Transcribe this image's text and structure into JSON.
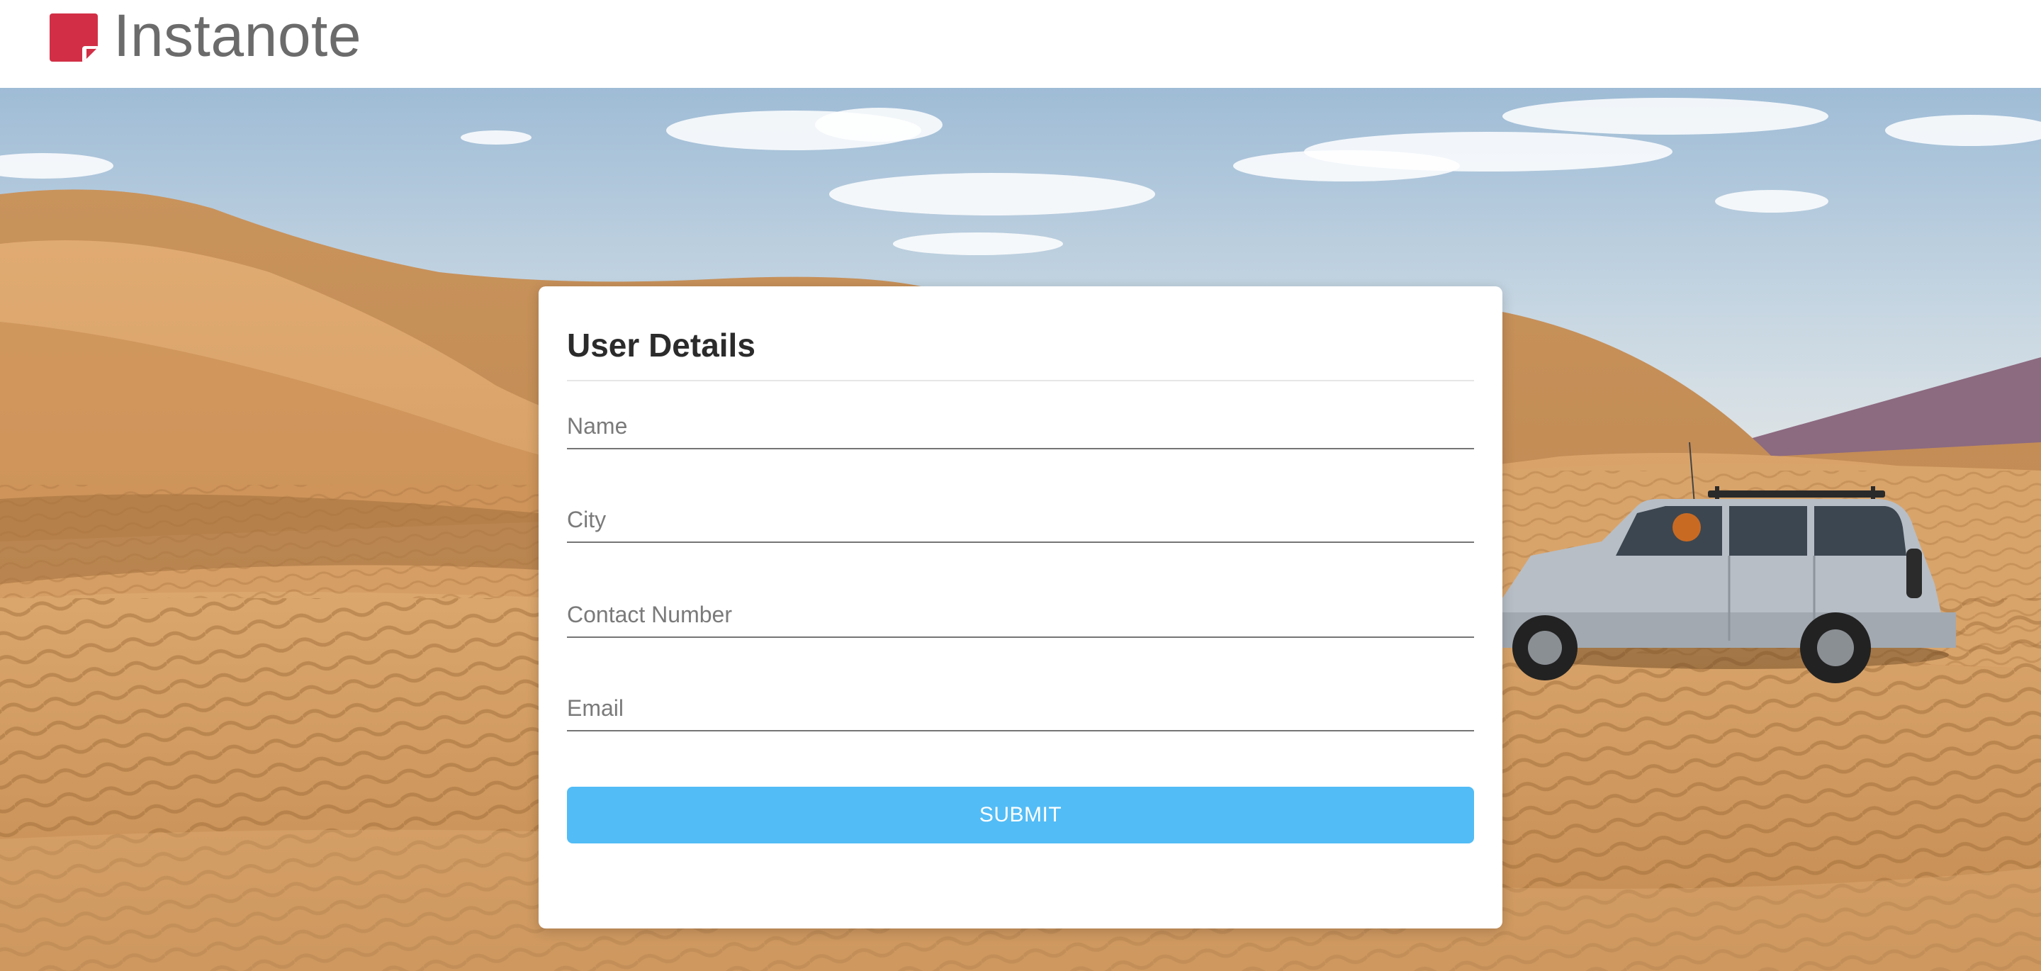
{
  "app": {
    "name": "Instanote",
    "logo_color": "#d22f46"
  },
  "hero": {
    "image": "desert-dunes-with-suv"
  },
  "form": {
    "title": "User Details",
    "fields": {
      "name": {
        "placeholder": "Name",
        "value": ""
      },
      "city": {
        "placeholder": "City",
        "value": ""
      },
      "contact": {
        "placeholder": "Contact Number",
        "value": ""
      },
      "email": {
        "placeholder": "Email",
        "value": ""
      }
    },
    "submit_label": "SUBMIT",
    "submit_color": "#52bcf6"
  }
}
